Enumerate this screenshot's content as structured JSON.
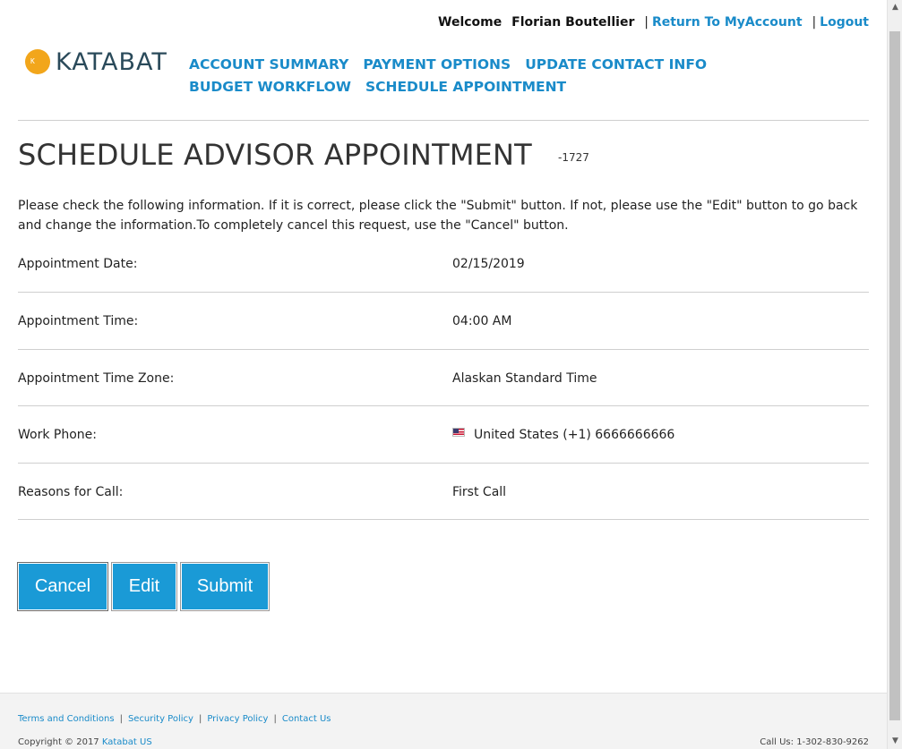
{
  "header": {
    "welcome": "Welcome",
    "user_name": "Florian Boutellier",
    "return_link": "Return To MyAccount",
    "logout_link": "Logout",
    "separator": "|"
  },
  "logo": {
    "mark_text": "Katabat",
    "text": "KATABAT",
    "mark_color": "#f2a61b"
  },
  "nav": {
    "items": [
      "ACCOUNT SUMMARY",
      "PAYMENT OPTIONS",
      "UPDATE CONTACT INFO",
      "BUDGET WORKFLOW",
      "SCHEDULE APPOINTMENT"
    ]
  },
  "page": {
    "title": "SCHEDULE ADVISOR APPOINTMENT",
    "title_suffix": "-1727",
    "instructions": "Please check the following information. If it is correct, please click the \"Submit\" button. If not, please use the \"Edit\" button to go back and change the information.To completely cancel this request, use the \"Cancel\" button."
  },
  "details": [
    {
      "label": "Appointment Date:",
      "value": "02/15/2019"
    },
    {
      "label": "Appointment Time:",
      "value": "04:00 AM"
    },
    {
      "label": "Appointment Time Zone:",
      "value": "Alaskan Standard Time"
    },
    {
      "label": "Work Phone:",
      "value": "United States (+1) 6666666666",
      "icon": "us-flag-icon"
    },
    {
      "label": "Reasons for Call:",
      "value": "First Call"
    }
  ],
  "buttons": {
    "cancel": "Cancel",
    "edit": "Edit",
    "submit": "Submit"
  },
  "footer": {
    "links": [
      "Terms and Conditions",
      "Security Policy",
      "Privacy Policy",
      "Contact Us"
    ],
    "copyright": "Copyright © 2017",
    "company": "Katabat US",
    "callus": "Call Us:  1-302-830-9262"
  },
  "colors": {
    "accent": "#1a8bc9",
    "button": "#1a9ad6"
  }
}
